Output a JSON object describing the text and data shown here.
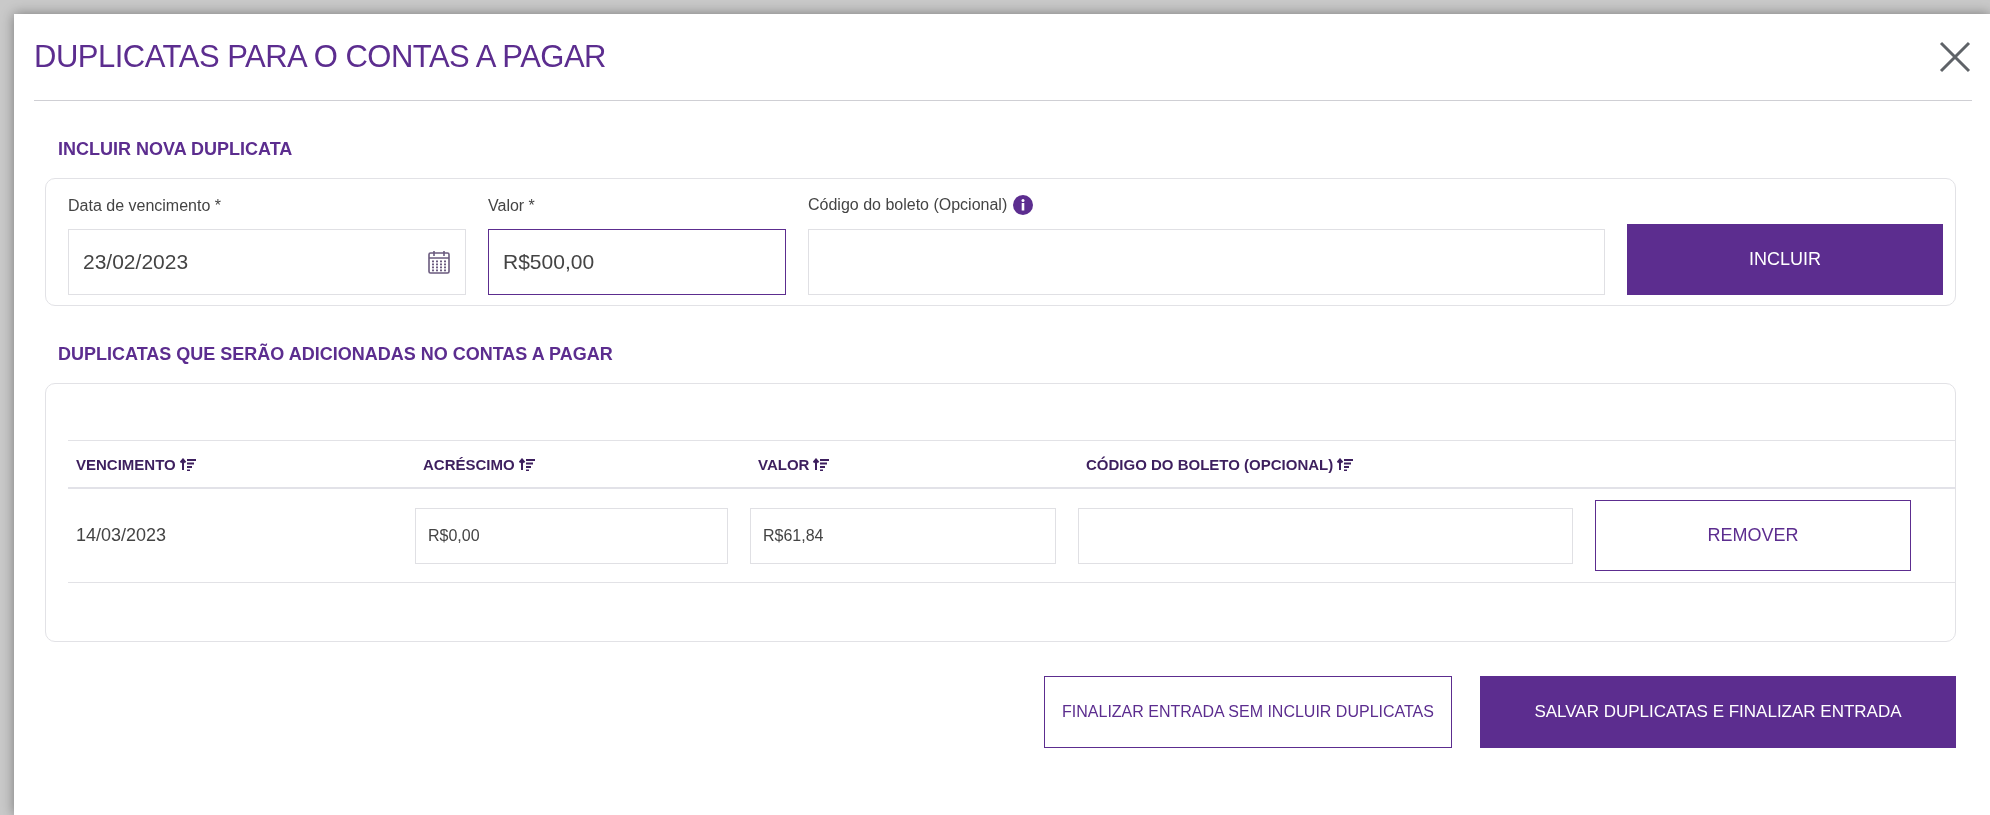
{
  "dialog": {
    "title": "DUPLICATAS PARA O CONTAS A PAGAR"
  },
  "new_entry": {
    "heading": "INCLUIR NOVA DUPLICATA",
    "fields": [
      {
        "kind": "date",
        "label": "Data de vencimento *",
        "value": "23/02/2023",
        "focused": false
      },
      {
        "kind": "text",
        "label": "Valor *",
        "value": "R$500,00",
        "focused": true
      },
      {
        "kind": "info",
        "label": "Código do boleto (Opcional)",
        "focused": false
      }
    ],
    "button": "INCLUIR"
  },
  "list": {
    "heading": "DUPLICATAS QUE SERÃO ADICIONADAS NO CONTAS A PAGAR",
    "columns": [
      "VENCIMENTO",
      "ACRÉSCIMO",
      "VALOR",
      "CÓDIGO DO BOLETO (OPCIONAL)"
    ],
    "rows": [
      {
        "vencimento": "14/03/2023",
        "acrescimo": "R$0,00",
        "valor": "R$61,84",
        "action": "REMOVER"
      }
    ]
  },
  "footer": {
    "secondary": "FINALIZAR ENTRADA SEM INCLUIR DUPLICATAS",
    "primary": "SALVAR DUPLICATAS E FINALIZAR ENTRADA"
  }
}
